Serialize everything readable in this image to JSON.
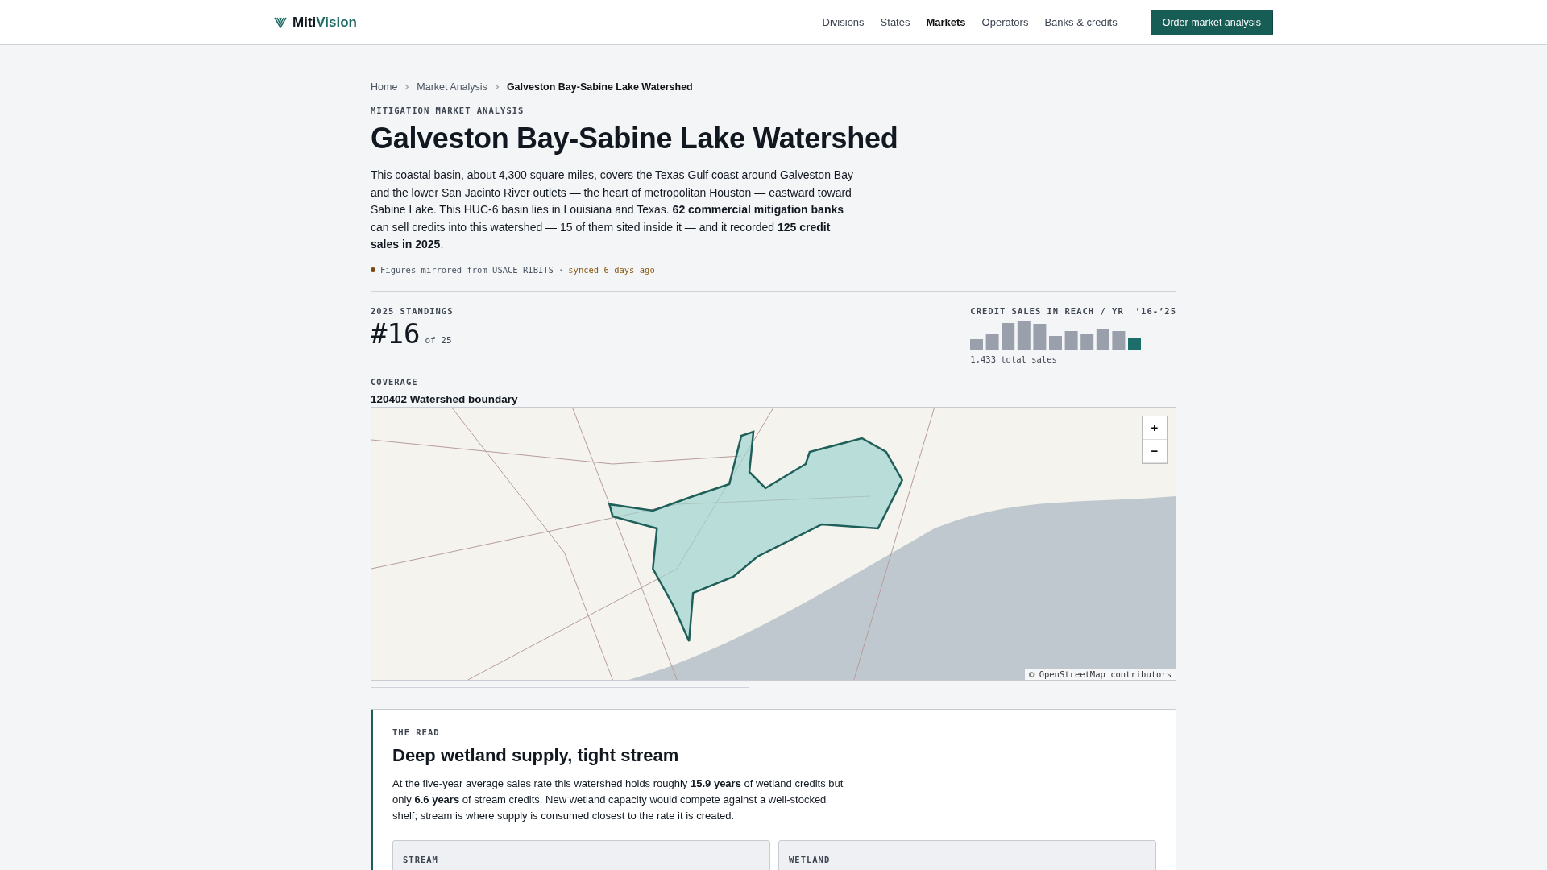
{
  "brand": {
    "first": "Miti",
    "second": "Vision"
  },
  "nav": [
    {
      "label": "Divisions",
      "selected": false
    },
    {
      "label": "States",
      "selected": false
    },
    {
      "label": "Markets",
      "selected": true
    },
    {
      "label": "Operators",
      "selected": false
    },
    {
      "label": "Banks & credits",
      "selected": false
    }
  ],
  "cta": "Order market analysis",
  "breadcrumb": [
    "Home",
    "Market Analysis",
    "Galveston Bay-Sabine Lake Watershed"
  ],
  "eyebrow": "MITIGATION MARKET ANALYSIS",
  "title": "Galveston Bay-Sabine Lake Watershed",
  "intro": "This coastal basin, about 4,300 square miles, covers the Texas Gulf coast around Galveston Bay and the lower San Jacinto River outlets — the heart of metropolitan Houston — eastward toward Sabine Lake. This HUC-6 basin lies in Louisiana and Texas. **62 commercial mitigation banks** can sell credits into this watershed — 15 of them sited inside it — and it recorded **125 credit sales in 2025**.",
  "source": {
    "text": "Figures mirrored from USACE RIBITS",
    "separator": "·",
    "synced": "synced 6 days ago"
  },
  "standings": {
    "label": "2025 STANDINGS",
    "rank": "#16",
    "of": "of 25"
  },
  "sales": {
    "label": "CREDIT SALES IN REACH / YR",
    "range": "’16-’25",
    "total": "1,433 total sales"
  },
  "coverage": {
    "label": "COVERAGE",
    "boundary": "120402 Watershed boundary",
    "zoom_in": "+",
    "zoom_out": "−",
    "attribution": "© OpenStreetMap contributors"
  },
  "read": {
    "eyebrow": "THE READ",
    "title": "Deep wetland supply, tight stream",
    "body": "At the five-year average sales rate this watershed holds roughly **15.9 years** of wetland credits but only **6.6 years** of stream credits. New wetland capacity would compete against a well-stocked shelf; stream is where supply is consumed closest to the rate it is created.",
    "panels": [
      "STREAM",
      "WETLAND"
    ]
  }
}
